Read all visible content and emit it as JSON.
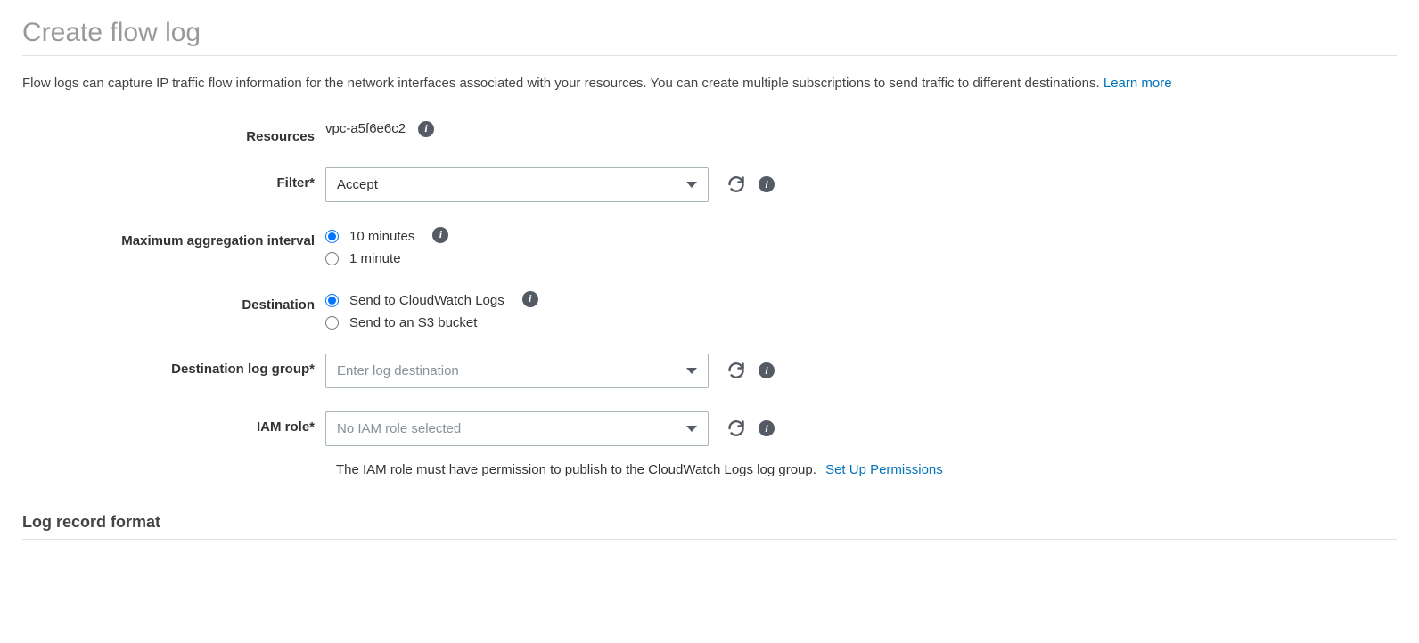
{
  "page": {
    "title": "Create flow log",
    "description": "Flow logs can capture IP traffic flow information for the network interfaces associated with your resources. You can create multiple subscriptions to send traffic to different destinations.",
    "learn_more": "Learn more"
  },
  "form": {
    "resources": {
      "label": "Resources",
      "value": "vpc-a5f6e6c2"
    },
    "filter": {
      "label": "Filter*",
      "value": "Accept"
    },
    "max_aggregation": {
      "label": "Maximum aggregation interval",
      "opt1": "10 minutes",
      "opt2": "1 minute"
    },
    "destination": {
      "label": "Destination",
      "opt1": "Send to CloudWatch Logs",
      "opt2": "Send to an S3 bucket"
    },
    "log_group": {
      "label": "Destination log group*",
      "placeholder": "Enter log destination"
    },
    "iam_role": {
      "label": "IAM role*",
      "placeholder": "No IAM role selected"
    },
    "iam_hint": {
      "text": "The IAM role must have permission to publish to the CloudWatch Logs log group.",
      "link": "Set Up Permissions"
    }
  },
  "section": {
    "log_format": "Log record format"
  }
}
